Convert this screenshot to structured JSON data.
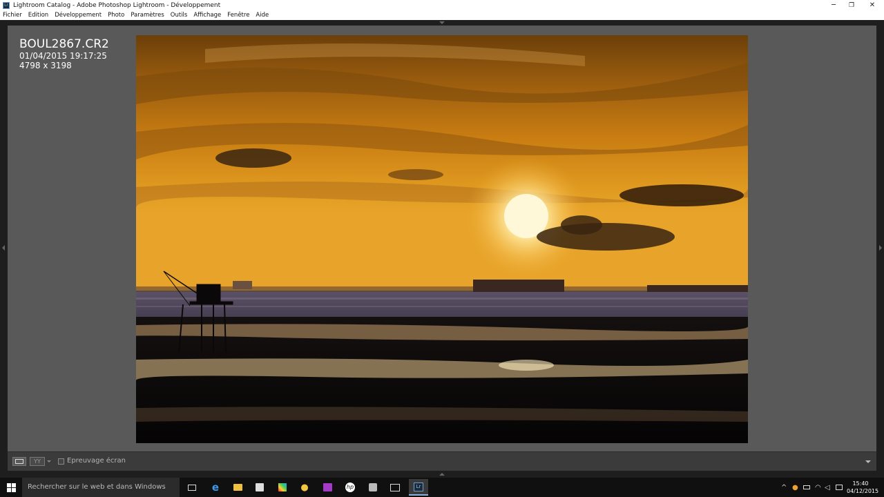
{
  "window": {
    "title": "Lightroom Catalog - Adobe Photoshop Lightroom - Développement",
    "app_icon": "Lr",
    "controls": [
      "minimize-icon",
      "restore-icon",
      "close-icon"
    ]
  },
  "menu": {
    "items": [
      "Fichier",
      "Edition",
      "Développement",
      "Photo",
      "Paramètres",
      "Outils",
      "Affichage",
      "Fenêtre",
      "Aide"
    ]
  },
  "photo_info": {
    "filename": "BOUL2867.CR2",
    "datetime": "01/04/2015 19:17:25",
    "dimensions": "4798 x 3198"
  },
  "toolbar": {
    "soft_proof_label": "Epreuvage écran",
    "soft_proof_checked": false,
    "view_loupe": "loupe-view-icon",
    "view_compare": "before-after-icon"
  },
  "taskbar": {
    "search_placeholder": "Rechercher sur le web et dans Windows",
    "time": "15:40",
    "date": "04/12/2015",
    "apps": [
      "task-view-icon",
      "edge-icon",
      "file-explorer-icon",
      "store-icon",
      "photos-app-icon",
      "hint-icon",
      "onenote-icon",
      "hp-icon",
      "app-icon",
      "image-viewer-icon",
      "lightroom-icon"
    ],
    "tray": [
      "chevron-up-icon",
      "network-icon",
      "battery-icon",
      "wifi-icon",
      "volume-icon",
      "notification-icon"
    ]
  },
  "colors": {
    "workarea": "#595959",
    "toolbar": "#3b3b3b",
    "sky_top": "#6b3f0a",
    "sun": "#fff3c0"
  }
}
